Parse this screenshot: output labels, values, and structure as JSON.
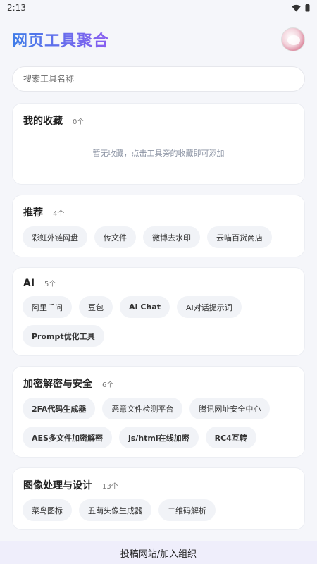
{
  "status": {
    "time": "2:13",
    "icons": [
      "wifi-icon",
      "battery-icon"
    ]
  },
  "header": {
    "title": "网页工具聚合",
    "avatar": "avatar"
  },
  "search": {
    "placeholder": "搜索工具名称",
    "value": ""
  },
  "favorites": {
    "title": "我的收藏",
    "count": "0个",
    "empty_text": "暂无收藏，点击工具旁的收藏即可添加"
  },
  "sections": [
    {
      "title": "推荐",
      "count": "4个",
      "chips": [
        "彩虹外链网盘",
        "传文件",
        "微博去水印",
        "云喵百货商店"
      ]
    },
    {
      "title": "AI",
      "count": "5个",
      "chips": [
        "阿里千问",
        "豆包",
        "AI Chat",
        "AI对话提示词",
        "Prompt优化工具"
      ]
    },
    {
      "title": "加密解密与安全",
      "count": "6个",
      "chips": [
        "2FA代码生成器",
        "恶意文件检测平台",
        "腾讯网址安全中心",
        "AES多文件加密解密",
        "js/html在线加密",
        "RC4互转"
      ]
    },
    {
      "title": "图像处理与设计",
      "count": "13个",
      "chips": [
        "菜鸟图标",
        "丑萌头像生成器",
        "二维码解析"
      ]
    }
  ],
  "footer": {
    "label": "投稿网站/加入组织"
  },
  "colors": {
    "title_gradient_start": "#3f7de8",
    "title_gradient_end": "#8a5ef0",
    "footer_bg": "#efeefb"
  }
}
